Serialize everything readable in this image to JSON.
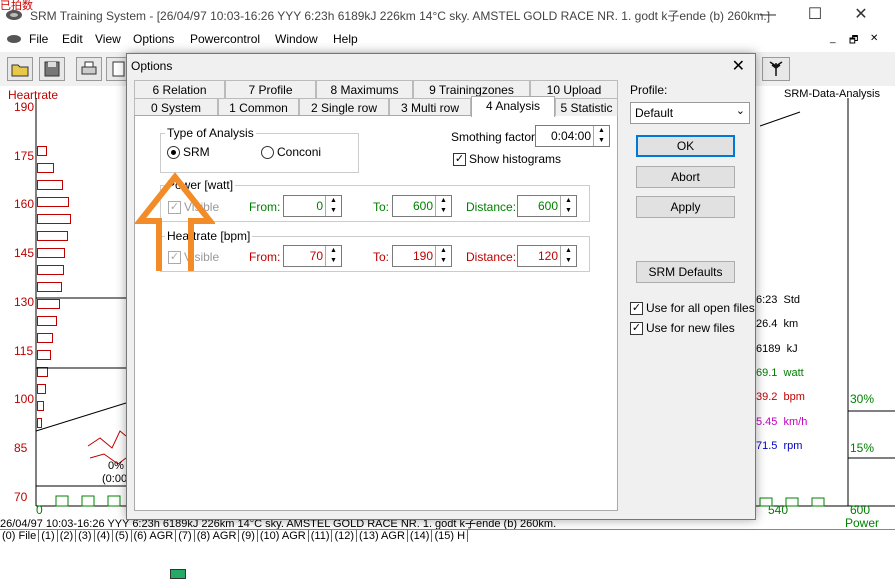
{
  "window": {
    "title": "SRM Training System - [26/04/97 10:03-16:26 YYY 6:23h 6189kJ 226km 14°C sky. AMSTEL GOLD RACE NR. 1. godt k子ende (b) 260km.]",
    "corner_text": "已拍数",
    "minimize": "—",
    "maximize": "☐",
    "close": "✕"
  },
  "menu": [
    "File",
    "Edit",
    "View",
    "Options",
    "Powercontrol",
    "Window",
    "Help"
  ],
  "mdi_controls": [
    "_",
    "🗗",
    "✕"
  ],
  "chart": {
    "left_axis_title": "Heartrate",
    "left_ticks": [
      "190",
      "175",
      "160",
      "145",
      "130",
      "115",
      "100",
      "85",
      "70"
    ],
    "right_title": "SRM-Data-Analysis",
    "stats": [
      {
        "text": "6:23  Std",
        "color": "#000000"
      },
      {
        "text": "26.4  km",
        "color": "#000000"
      },
      {
        "text": "6189  kJ",
        "color": "#000000"
      },
      {
        "text": "69.1  watt",
        "color": "#008000"
      },
      {
        "text": "39.2  bpm",
        "color": "#c00000"
      },
      {
        "text": "5.45  km/h",
        "color": "#c000c0"
      },
      {
        "text": "71.5  rpm",
        "color": "#0000c0"
      }
    ],
    "right_pcts": [
      "30%",
      "15%"
    ],
    "bottom_labels": {
      "x0": "0",
      "x540": "540",
      "x600": "600",
      "power": "Power",
      "pct0": "0%",
      "pct_sub": "(0:00"
    },
    "left_bar_values": [
      0.24,
      0.47,
      0.74,
      0.95,
      1.0,
      0.9,
      0.82,
      0.77,
      0.72,
      0.65,
      0.55,
      0.45,
      0.37,
      0.29,
      0.22,
      0.15,
      0.1
    ]
  },
  "status_line": "26/04/97 10:03-16:26 YYY 6:23h 6189kJ 226km 14°C sky. AMSTEL GOLD RACE NR. 1. godt k子ende (b) 260km.",
  "bottom_tabs": [
    "(0) File",
    "(1)",
    "(2)",
    "(3)",
    "(4)",
    "(5)",
    "(6) AGR",
    "(7)",
    "(8) AGR",
    "(9)",
    "(10) AGR",
    "(11)",
    "(12)",
    "(13) AGR",
    "(14)",
    "(15) H"
  ],
  "dialog": {
    "title": "Options",
    "close": "✕",
    "tabs_row1": [
      "6 Relation",
      "7 Profile",
      "8 Maximums",
      "9 Trainingzones",
      "10 Upload"
    ],
    "tabs_row2": [
      "0 System",
      "1 Common",
      "2 Single row",
      "3 Multi row",
      "4 Analysis",
      "5 Statistic"
    ],
    "selected_tab": "4 Analysis",
    "type_of_analysis": {
      "label": "Type of Analysis",
      "options": [
        "SRM",
        "Conconi"
      ],
      "selected": "SRM"
    },
    "smoothing": {
      "label": "Smothing factor:",
      "value": "0:04:00"
    },
    "show_histograms": {
      "label": "Show histograms",
      "checked": true
    },
    "power": {
      "label": "Power [watt]",
      "visible_label": "Visible",
      "from_label": "From:",
      "from": "0",
      "to_label": "To:",
      "to": "600",
      "distance_label": "Distance:",
      "distance": "600"
    },
    "heartrate": {
      "label": "Heartrate [bpm]",
      "visible_label": "Visible",
      "from_label": "From:",
      "from": "70",
      "to_label": "To:",
      "to": "190",
      "distance_label": "Distance:",
      "distance": "120"
    },
    "profile": {
      "label": "Profile:",
      "value": "Default"
    },
    "buttons": {
      "ok": "OK",
      "abort": "Abort",
      "apply": "Apply",
      "srm_defaults": "SRM Defaults"
    },
    "use_all_open": {
      "label": "Use for all open files",
      "checked": true
    },
    "use_new": {
      "label": "Use for new files",
      "checked": true
    },
    "colors": {
      "accent": "#0078d7",
      "power": "#008000",
      "heartrate": "#c00000",
      "annotation_arrow": "#f28c28"
    }
  }
}
